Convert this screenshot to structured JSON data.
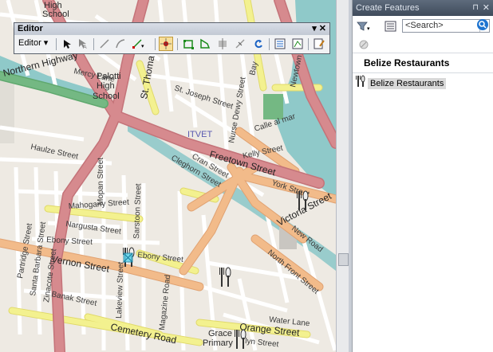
{
  "map": {
    "labels": {
      "high_school_top": "High",
      "high_school_top2": "School",
      "mercy_lane": "Mercy Lane",
      "palotti1": "Palotti",
      "palotti2": "High",
      "palotti3": "School",
      "northern_highway": "Northern Highway",
      "st_thomas": "St. Thoma",
      "st_joseph": "St. Joseph Street",
      "bay": "Bay",
      "newtown": "Newtown",
      "nurse_dewy": "Nurse Dewy Street",
      "calle_al_mar": "Calle al mar",
      "itvet": "ITVET",
      "haulze": "Haulze Street",
      "kelly": "Kelly Street",
      "freetown": "Freetown Street",
      "cran": "Cran Street",
      "cleghorn": "Cleghorn Street",
      "york": "York Street",
      "victoria": "Victoria Street",
      "new_road": "New Road",
      "north_front": "North Front Street",
      "mahogany": "Mahogany Street",
      "nargusta": "Nargusta Street",
      "ebony1": "Ebony Street",
      "ebony2": "Ebony Street",
      "vernon": "Vernon Street",
      "partridge": "Partridge Street",
      "santa_barbara": "Santa Barbara Street",
      "zinacote": "Zinacote Street",
      "banak": "Banak Street",
      "lakeview": "Lakeview Street",
      "magazine": "Magazine Road",
      "cemetery": "Cemetery Road",
      "water_lane": "Water Lane",
      "orange": "Orange Street",
      "grace1": "Grace",
      "grace2": "Primary",
      "lyn": "lyn Street",
      "mopan": "Mopan Street",
      "sarstoon": "Sarstoon Street"
    },
    "colors": {
      "land": "#eeeae3",
      "water": "#8fc9c9",
      "trunk": "#d68a8e",
      "primary": "#f2bb8a",
      "secondary": "#f3f18f",
      "park": "#74b883"
    }
  },
  "editor": {
    "title": "Editor",
    "menu_label": "Editor ▾",
    "controls": "▾ ✕",
    "tools": [
      "edit-pointer-icon",
      "edit-annotation-icon",
      "straight-segment-icon",
      "end-point-arc-icon",
      "trace-icon",
      "point-tool-icon",
      "edit-vertices-icon",
      "reshape-feature-icon",
      "cut-polygons-icon",
      "split-tool-icon",
      "rotate-tool-icon",
      "attributes-icon",
      "sketch-properties-icon",
      "create-features-icon"
    ]
  },
  "create_features": {
    "title": "Create Features",
    "pin": "⊓",
    "close": "✕",
    "search_placeholder": "<Search>",
    "layer_name": "Belize Restaurants",
    "template_label": "Belize Restaurants"
  }
}
